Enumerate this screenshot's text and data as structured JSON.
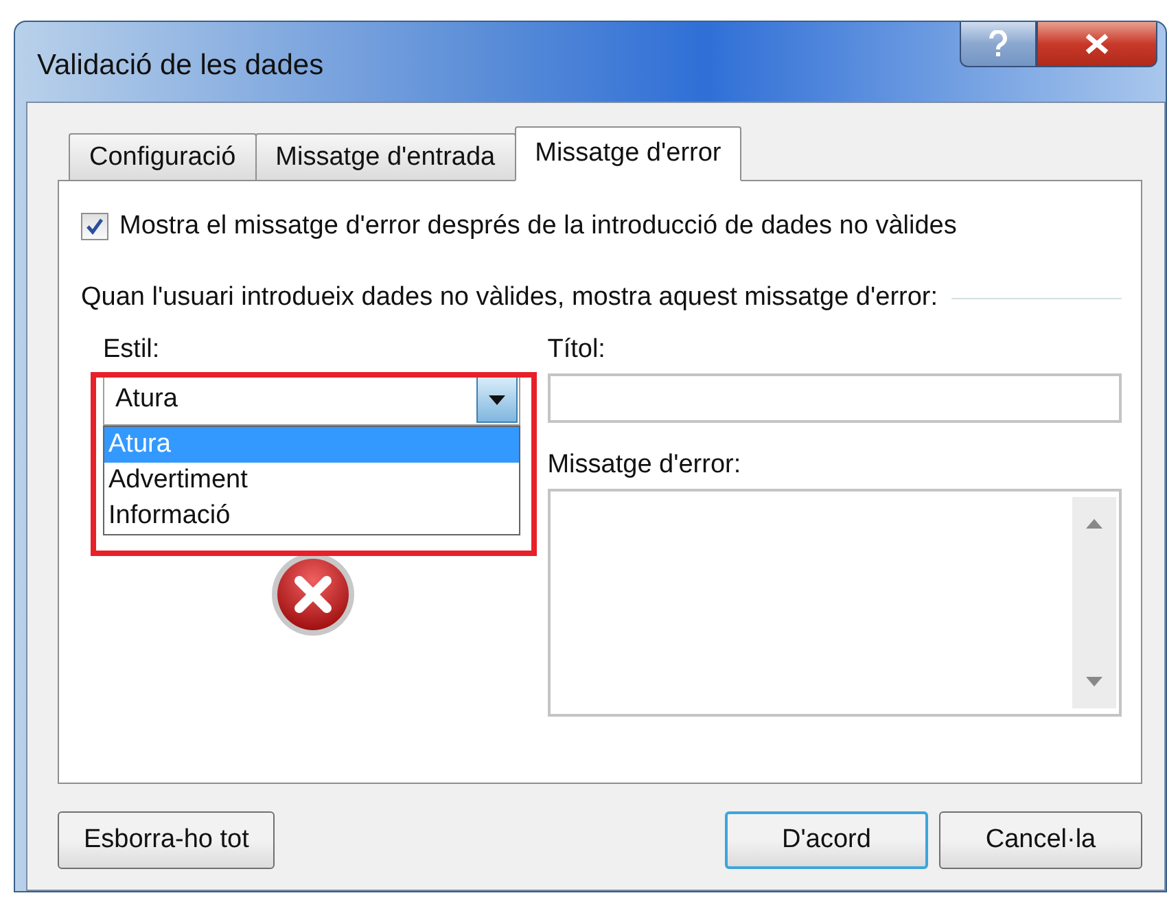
{
  "window": {
    "title": "Validació de les dades"
  },
  "tabs": [
    {
      "label": "Configuració",
      "selected": false
    },
    {
      "label": "Missatge d'entrada",
      "selected": false
    },
    {
      "label": "Missatge d'error",
      "selected": true
    }
  ],
  "show_error_checkbox": {
    "label": "Mostra el missatge d'error després de la introducció de dades no vàlides",
    "checked": true
  },
  "section_label": "Quan l'usuari introdueix dades no vàlides, mostra aquest missatge d'error:",
  "style": {
    "label": "Estil:",
    "value": "Atura",
    "expanded": true,
    "options": [
      {
        "label": "Atura",
        "selected": true
      },
      {
        "label": "Advertiment",
        "selected": false
      },
      {
        "label": "Informació",
        "selected": false
      }
    ]
  },
  "title_field": {
    "label": "Títol:"
  },
  "message_field": {
    "label": "Missatge d'error:"
  },
  "buttons": [
    {
      "label": "Esborra-ho tot",
      "kind": "plain"
    },
    {
      "label": "D'acord",
      "kind": "default"
    },
    {
      "label": "Cancel·la",
      "kind": "plain"
    }
  ]
}
